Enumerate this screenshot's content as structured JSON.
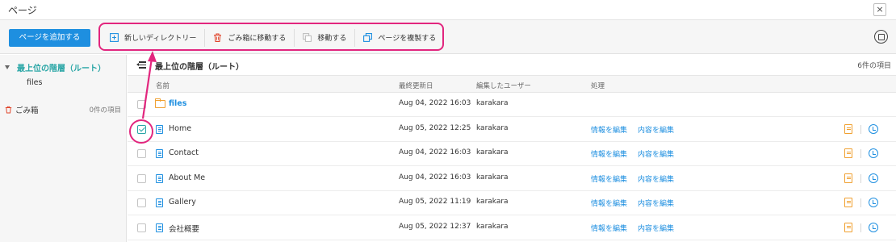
{
  "window": {
    "title": "ページ",
    "close": "×"
  },
  "toolbar": {
    "add_page": "ページを追加する",
    "actions": [
      {
        "label": "新しいディレクトリー",
        "icon": "new-folder-icon"
      },
      {
        "label": "ごみ箱に移動する",
        "icon": "trash-icon"
      },
      {
        "label": "移動する",
        "icon": "move-icon"
      },
      {
        "label": "ページを複製する",
        "icon": "duplicate-icon"
      }
    ]
  },
  "sidebar": {
    "root": "最上位の階層（ルート）",
    "child": "files",
    "trash": {
      "label": "ごみ箱",
      "count": "0件の項目"
    }
  },
  "main": {
    "breadcrumb": "最上位の階層（ルート）",
    "item_count": "6件の項目",
    "columns": {
      "name": "名前",
      "updated": "最終更新日",
      "user": "編集したユーザー",
      "actions": "処理"
    },
    "action_labels": {
      "edit_info": "情報を編集",
      "edit_content": "内容を編集"
    },
    "rows": [
      {
        "name": "files",
        "type": "folder",
        "date": "Aug 04, 2022 16:03",
        "user": "karakara",
        "checked": false
      },
      {
        "name": "Home",
        "type": "page",
        "date": "Aug 05, 2022 12:25",
        "user": "karakara",
        "checked": true
      },
      {
        "name": "Contact",
        "type": "page",
        "date": "Aug 04, 2022 16:03",
        "user": "karakara",
        "checked": false
      },
      {
        "name": "About Me",
        "type": "page",
        "date": "Aug 04, 2022 16:03",
        "user": "karakara",
        "checked": false
      },
      {
        "name": "Gallery",
        "type": "page",
        "date": "Aug 05, 2022 11:19",
        "user": "karakara",
        "checked": false
      },
      {
        "name": "会社概要",
        "type": "page",
        "date": "Aug 05, 2022 12:37",
        "user": "karakara",
        "checked": false
      }
    ]
  },
  "colors": {
    "accent": "#1e8fe0",
    "teal": "#2aa6a6",
    "annotation": "#e2267e",
    "folder": "#f0a030"
  }
}
